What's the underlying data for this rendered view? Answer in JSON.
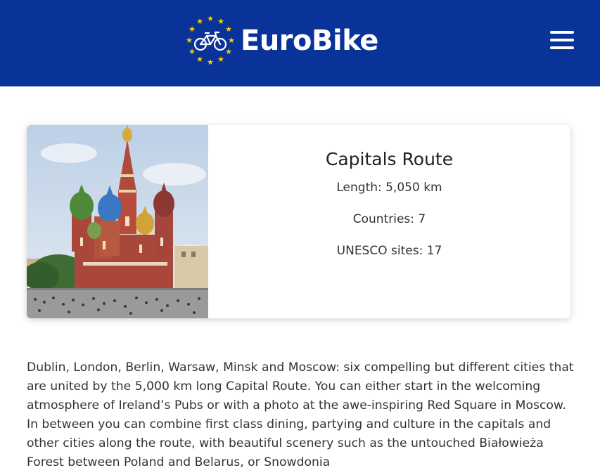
{
  "brand": {
    "name": "EuroBike"
  },
  "route": {
    "title": "Capitals Route",
    "length": "Length: 5,050 km",
    "countries": "Countries: 7",
    "unesco": "UNESCO sites: 17"
  },
  "description": "Dublin, London, Berlin, Warsaw, Minsk and Moscow: six compelling but different cities that are united by the 5,000 km long Capital Route. You can either start in the welcoming atmosphere of Ireland’s Pubs or with a photo at the awe-inspiring Red Square in Moscow. In between you can combine first class dining, partying and culture in the capitals and other cities along the route, with beautiful scenery such as the untouched Białowieża Forest between Poland and Belarus, or Snowdonia",
  "colors": {
    "header": "#0a3399",
    "stars": "#ffcc00"
  },
  "icons": {
    "menu": "hamburger-menu-icon",
    "logo": "bicycle-stars-logo"
  }
}
